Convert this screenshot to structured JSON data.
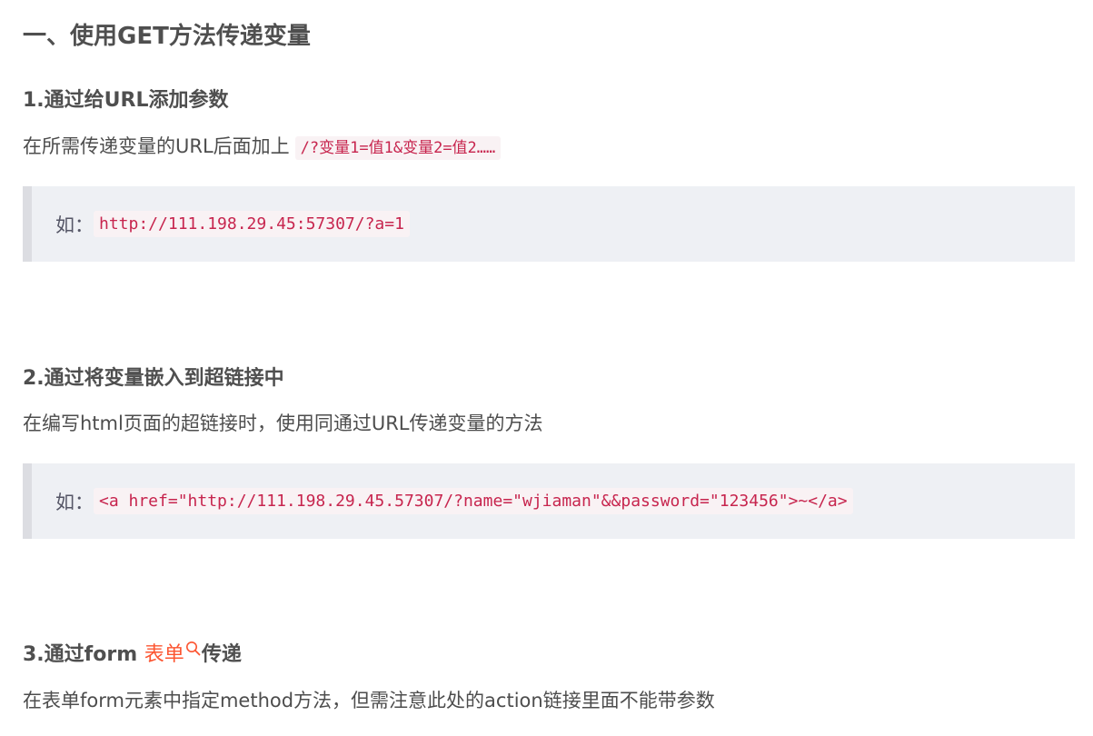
{
  "article": {
    "heading": "一、使用GET方法传递变量",
    "sections": [
      {
        "title": "1.通过给URL添加参数",
        "text": "在所需传递变量的URL后面加上",
        "inline_code": "/?变量1=值1&变量2=值2……",
        "example_label": "如：",
        "example_code": "http://111.198.29.45:57307/?a=1"
      },
      {
        "title": "2.通过将变量嵌入到超链接中",
        "text": "在编写html页面的超链接时，使用同通过URL传递变量的方法",
        "example_label": "如：",
        "example_code": "<a href=\"http://111.198.29.45.57307/?name=\"wjiaman\"&&password=\"123456\">~</a>"
      },
      {
        "title_prefix": "3.通过form ",
        "title_link": "表单",
        "title_suffix": "传递",
        "text": "在表单form元素中指定method方法，但需注意此处的action链接里面不能带参数"
      }
    ]
  },
  "colors": {
    "text": "#4d4d4d",
    "code": "#c7254e",
    "code_bg": "#f9f2f4",
    "quote_bg": "#eef0f4",
    "quote_border": "#dcdde2",
    "link": "#fc5531"
  },
  "icons": {
    "search": "search-icon"
  }
}
